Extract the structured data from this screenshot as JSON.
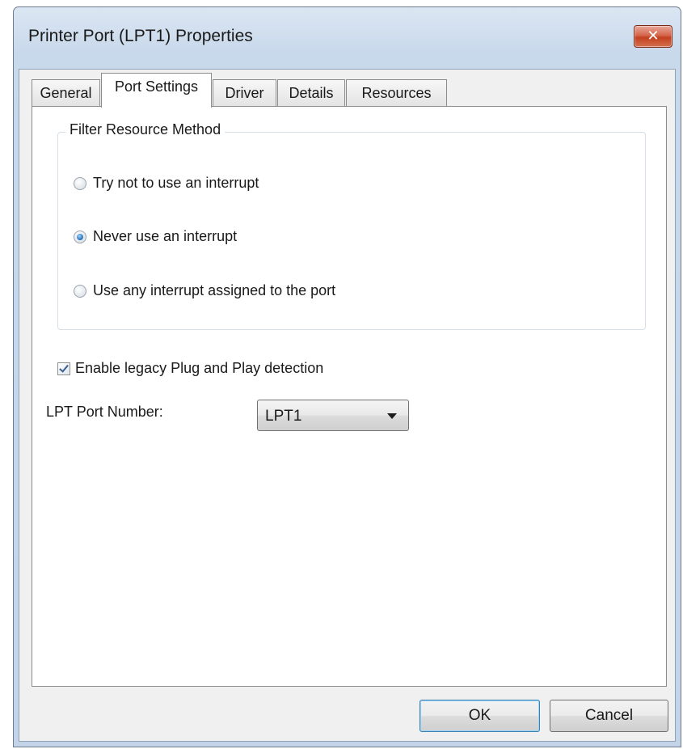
{
  "window": {
    "title": "Printer Port (LPT1) Properties",
    "close_icon": "close-icon"
  },
  "tabs": [
    {
      "label": "General",
      "active": false
    },
    {
      "label": "Port Settings",
      "active": true
    },
    {
      "label": "Driver",
      "active": false
    },
    {
      "label": "Details",
      "active": false
    },
    {
      "label": "Resources",
      "active": false
    }
  ],
  "filter_resource": {
    "legend": "Filter Resource Method",
    "options": [
      {
        "label": "Try not to use an interrupt",
        "selected": false
      },
      {
        "label": "Never use an interrupt",
        "selected": true
      },
      {
        "label": "Use any interrupt assigned to the port",
        "selected": false
      }
    ]
  },
  "legacy_pnp": {
    "label": "Enable legacy Plug and Play detection",
    "checked": true
  },
  "lpt_port": {
    "label": "LPT Port Number:",
    "value": "LPT1"
  },
  "buttons": {
    "ok": "OK",
    "cancel": "Cancel"
  },
  "colors": {
    "title_bar": "#c3d4e9",
    "close_button": "#c2401f",
    "accent": "#2d7cc4"
  }
}
